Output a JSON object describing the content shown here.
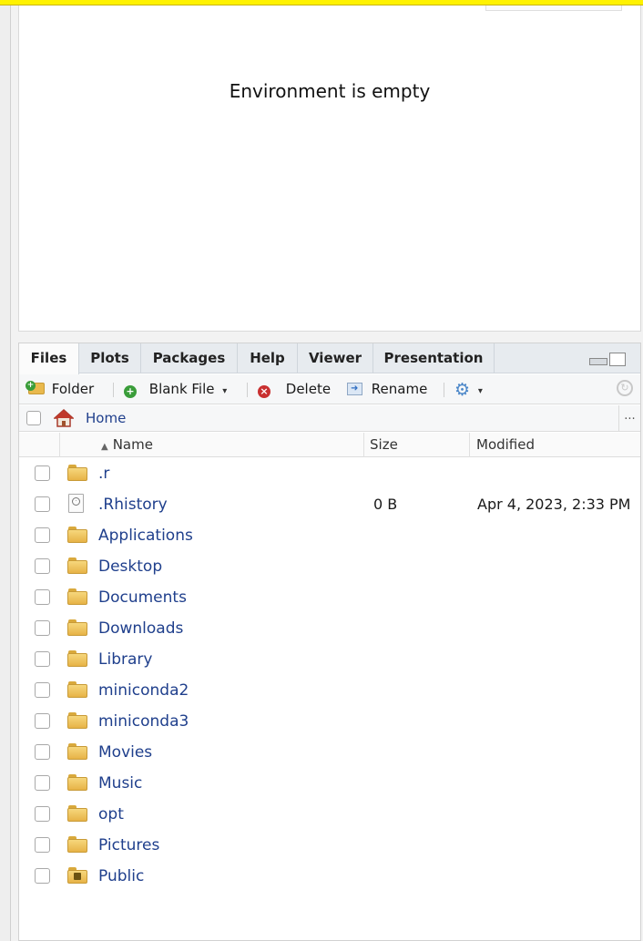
{
  "environment": {
    "empty_message": "Environment is empty"
  },
  "tabs": [
    {
      "label": "Files",
      "active": true
    },
    {
      "label": "Plots",
      "active": false
    },
    {
      "label": "Packages",
      "active": false
    },
    {
      "label": "Help",
      "active": false
    },
    {
      "label": "Viewer",
      "active": false
    },
    {
      "label": "Presentation",
      "active": false
    }
  ],
  "toolbar": {
    "folder": "Folder",
    "blank_file": "Blank File",
    "delete": "Delete",
    "rename": "Rename",
    "more_menu_icon": "gear-icon"
  },
  "path": {
    "home": "Home",
    "overflow": "..."
  },
  "columns": {
    "name": "Name",
    "size": "Size",
    "modified": "Modified"
  },
  "files": [
    {
      "name": ".r",
      "type": "folder",
      "size": "",
      "modified": ""
    },
    {
      "name": ".Rhistory",
      "type": "history",
      "size": "0 B",
      "modified": "Apr 4, 2023, 2:33 PM"
    },
    {
      "name": "Applications",
      "type": "folder",
      "size": "",
      "modified": ""
    },
    {
      "name": "Desktop",
      "type": "folder",
      "size": "",
      "modified": ""
    },
    {
      "name": "Documents",
      "type": "folder",
      "size": "",
      "modified": ""
    },
    {
      "name": "Downloads",
      "type": "folder",
      "size": "",
      "modified": ""
    },
    {
      "name": "Library",
      "type": "folder",
      "size": "",
      "modified": ""
    },
    {
      "name": "miniconda2",
      "type": "folder",
      "size": "",
      "modified": ""
    },
    {
      "name": "miniconda3",
      "type": "folder",
      "size": "",
      "modified": ""
    },
    {
      "name": "Movies",
      "type": "folder",
      "size": "",
      "modified": ""
    },
    {
      "name": "Music",
      "type": "folder",
      "size": "",
      "modified": ""
    },
    {
      "name": "opt",
      "type": "folder",
      "size": "",
      "modified": ""
    },
    {
      "name": "Pictures",
      "type": "folder",
      "size": "",
      "modified": ""
    },
    {
      "name": "Public",
      "type": "public-folder",
      "size": "",
      "modified": ""
    }
  ]
}
